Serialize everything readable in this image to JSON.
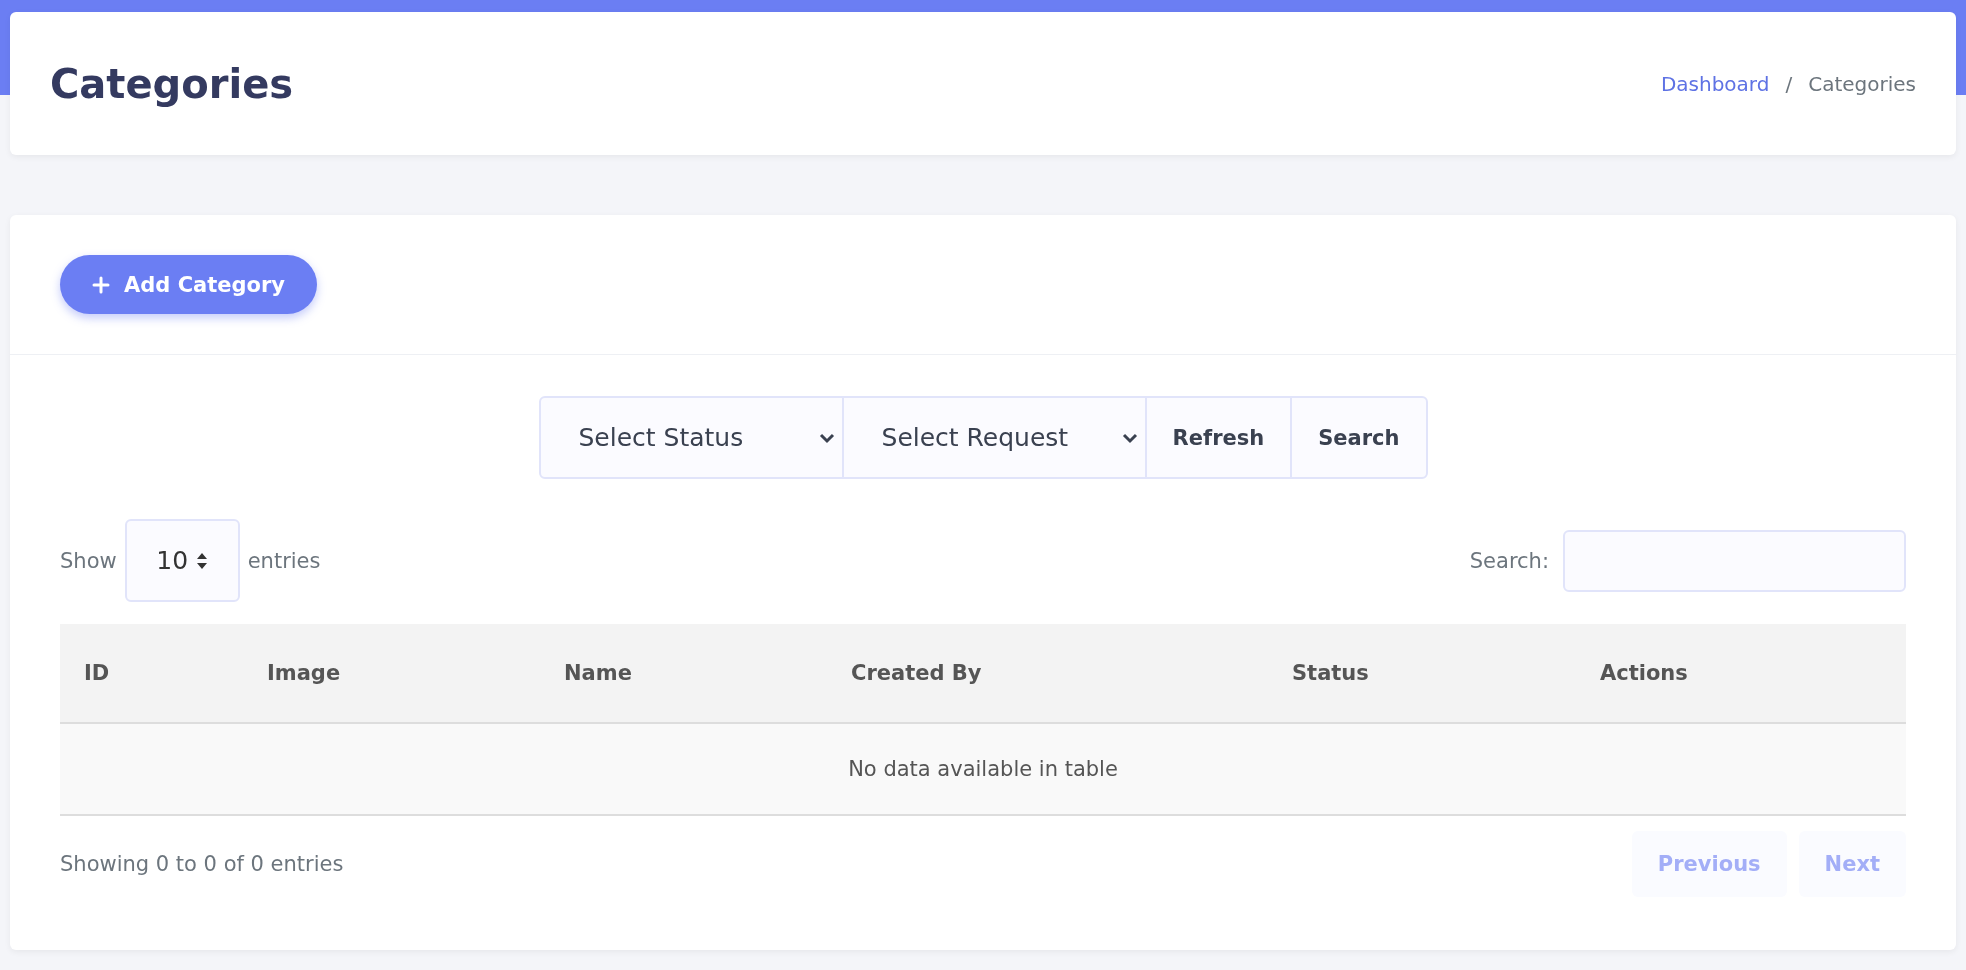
{
  "header": {
    "title": "Categories",
    "breadcrumb": [
      {
        "label": "Dashboard",
        "link": true
      },
      {
        "label": "Categories",
        "link": false
      }
    ],
    "separator": "/"
  },
  "add_button": {
    "label": "Add Category"
  },
  "filters": {
    "selects": [
      {
        "label": "Select Status"
      },
      {
        "label": "Select Request"
      }
    ],
    "buttons": [
      "Refresh",
      "Search"
    ]
  },
  "length": {
    "prefix": "Show",
    "value": "10",
    "suffix": "entries"
  },
  "search": {
    "label": "Search:"
  },
  "table": {
    "columns": [
      "ID",
      "Image",
      "Name",
      "Created By",
      "Status",
      "Actions"
    ],
    "empty": "No data available in table"
  },
  "info": "Showing 0 to 0 of 0 entries",
  "pagination": [
    {
      "label": "Previous",
      "disabled": true
    },
    {
      "label": "Next",
      "disabled": true
    }
  ]
}
